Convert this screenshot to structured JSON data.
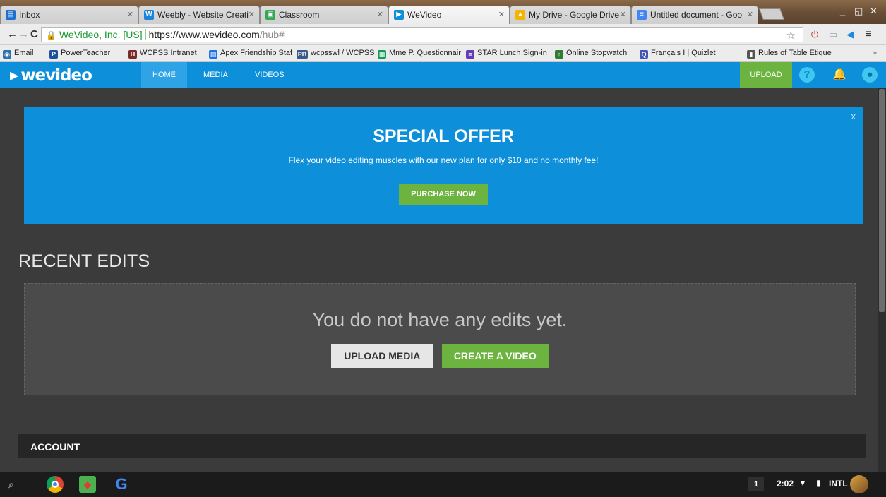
{
  "browser": {
    "tabs": [
      {
        "title": "Inbox",
        "fav_color": "#1e6fd1",
        "fav_glyph": "▤"
      },
      {
        "title": "Weebly - Website Creati",
        "fav_color": "#1b84d8",
        "fav_glyph": "W"
      },
      {
        "title": "Classroom",
        "fav_color": "#34a853",
        "fav_glyph": "▣"
      },
      {
        "title": "WeVideo",
        "fav_color": "#0d8fd9",
        "fav_glyph": "▶"
      },
      {
        "title": "My Drive - Google Drive",
        "fav_color": "#f4b400",
        "fav_glyph": "▲"
      },
      {
        "title": "Untitled document - Goo",
        "fav_color": "#4285f4",
        "fav_glyph": "≡"
      }
    ],
    "address": {
      "ev_label": "WeVideo, Inc. [US]",
      "host": "https://www.wevideo.com",
      "path": "/hub#"
    },
    "bookmarks": [
      {
        "label": "Email",
        "color": "#2a6fb0",
        "glyph": "◉"
      },
      {
        "label": "PowerTeacher",
        "color": "#1c4f9c",
        "glyph": "P"
      },
      {
        "label": "WCPSS Intranet",
        "color": "#7b2a2a",
        "glyph": "H"
      },
      {
        "label": "Apex Friendship Staf",
        "color": "#1a73e8",
        "glyph": "▤"
      },
      {
        "label": "wcpsswl / WCPSS W",
        "color": "#3a5a8a",
        "glyph": "PB"
      },
      {
        "label": "Mme P. Questionnair",
        "color": "#0f9d58",
        "glyph": "▦"
      },
      {
        "label": "STAR Lunch Sign-in",
        "color": "#673ab7",
        "glyph": "≡"
      },
      {
        "label": "Online Stopwatch",
        "color": "#2e7d32",
        "glyph": "↕"
      },
      {
        "label": "Français I | Quizlet",
        "color": "#4257b2",
        "glyph": "Q"
      },
      {
        "label": "Rules of Table Etique",
        "color": "#555555",
        "glyph": "▮"
      }
    ]
  },
  "nav": {
    "logo": "wevideo",
    "links": [
      "HOME",
      "MEDIA",
      "VIDEOS"
    ],
    "upload": "UPLOAD"
  },
  "offer": {
    "title": "SPECIAL OFFER",
    "text": "Flex your video editing muscles with our new plan for only $10 and no monthly fee!",
    "button": "PURCHASE NOW",
    "close": "x"
  },
  "recent": {
    "title": "RECENT EDITS",
    "empty_message": "You do not have any edits yet.",
    "upload_button": "UPLOAD MEDIA",
    "create_button": "CREATE A VIDEO"
  },
  "account": {
    "title": "ACCOUNT"
  },
  "shelf": {
    "badge": "1",
    "time": "2:02",
    "ime": "INTL"
  },
  "colors": {
    "brand_blue": "#0d8fd9",
    "brand_green": "#6cb33f",
    "background": "#3b3b3b"
  }
}
